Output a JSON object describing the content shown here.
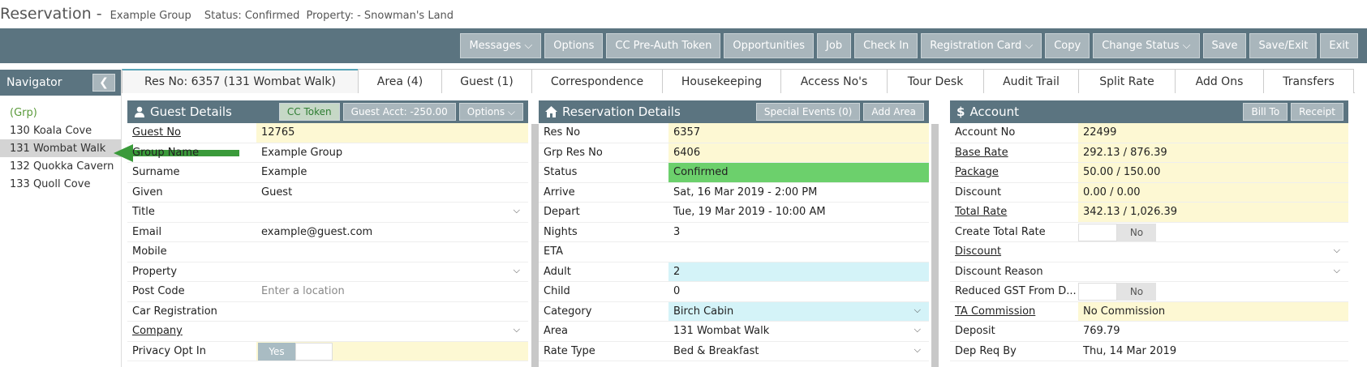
{
  "title": {
    "main": "Reservation",
    "sep": " - ",
    "group": "Example Group",
    "status": "Status: Confirmed",
    "property": "Property: - Snowman's Land"
  },
  "toolbar": [
    "Messages ⌵",
    "Options",
    "CC Pre-Auth Token",
    "Opportunities",
    "Job",
    "Check In",
    "Registration Card ⌵",
    "Copy",
    "Change Status ⌵",
    "Save",
    "Save/Exit",
    "Exit"
  ],
  "navigator": {
    "title": "Navigator",
    "collapse": "❮",
    "items": [
      "(Grp)",
      "130 Koala Cove",
      "131 Wombat Walk",
      "132 Quokka Cavern",
      "133 Quoll Cove"
    ]
  },
  "tabs": [
    "Res No: 6357 (131 Wombat Walk)",
    "Area (4)",
    "Guest (1)",
    "Correspondence",
    "Housekeeping",
    "Access No's",
    "Tour Desk",
    "Audit Trail",
    "Split Rate",
    "Add Ons",
    "Transfers"
  ],
  "guest": {
    "title": "Guest Details",
    "buttons": [
      "CC Token",
      "Guest Acct: -250.00",
      "Options ⌵"
    ],
    "rows": [
      [
        "Guest No",
        "12765"
      ],
      [
        "Group Name",
        "Example Group"
      ],
      [
        "Surname",
        "Example"
      ],
      [
        "Given",
        "Guest"
      ],
      [
        "Title",
        ""
      ],
      [
        "Email",
        "example@guest.com"
      ],
      [
        "Mobile",
        ""
      ],
      [
        "Property",
        ""
      ],
      [
        "Post Code",
        "Enter a location"
      ],
      [
        "Car Registration",
        ""
      ],
      [
        "Company",
        ""
      ],
      [
        "Privacy Opt In",
        "Yes"
      ]
    ]
  },
  "reservation": {
    "title": "Reservation Details",
    "buttons": [
      "Special Events (0)",
      "Add Area"
    ],
    "rows": [
      [
        "Res No",
        "6357"
      ],
      [
        "Grp Res No",
        "6406"
      ],
      [
        "Status",
        "Confirmed"
      ],
      [
        "Arrive",
        "Sat, 16 Mar 2019 - 2:00 PM"
      ],
      [
        "Depart",
        "Tue, 19 Mar 2019 - 10:00 AM"
      ],
      [
        "Nights",
        "3"
      ],
      [
        "ETA",
        ""
      ],
      [
        "Adult",
        "2"
      ],
      [
        "Child",
        "0"
      ],
      [
        "Category",
        "Birch Cabin"
      ],
      [
        "Area",
        "131 Wombat Walk"
      ],
      [
        "Rate Type",
        "Bed & Breakfast"
      ]
    ]
  },
  "account": {
    "title": "Account",
    "buttons": [
      "Bill To",
      "Receipt"
    ],
    "rows": [
      [
        "Account No",
        "22499"
      ],
      [
        "Base Rate",
        "292.13 / 876.39"
      ],
      [
        "Package",
        "50.00 / 150.00"
      ],
      [
        "Discount",
        "0.00 / 0.00"
      ],
      [
        "Total Rate",
        "342.13 / 1,026.39"
      ],
      [
        "Create Total Rate",
        "No"
      ],
      [
        "Discount",
        ""
      ],
      [
        "Discount Reason",
        ""
      ],
      [
        "Reduced GST From D...",
        "No"
      ],
      [
        "TA Commission",
        "No Commission"
      ],
      [
        "Deposit",
        "769.79"
      ],
      [
        "Dep Req By",
        "Thu, 14 Mar 2019"
      ]
    ]
  },
  "colors": {
    "header": "#5b7480",
    "button": "#a9b6bc",
    "highlight_yellow": "#fdf8d3",
    "highlight_cyan": "#d4f3f8",
    "status_green": "#6cd06c",
    "arrow_green": "#3a9a3a"
  }
}
